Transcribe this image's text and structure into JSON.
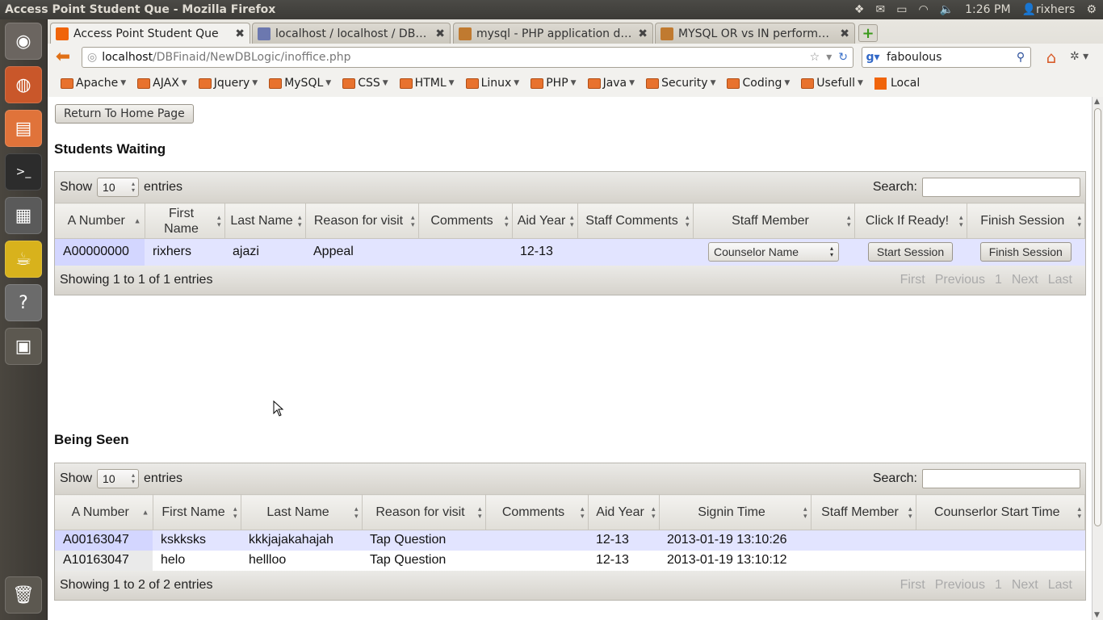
{
  "window": {
    "title": "Access Point Student Que - Mozilla Firefox"
  },
  "tray": {
    "time": "1:26 PM",
    "user": "rixhers"
  },
  "tabs": [
    {
      "label": "Access Point Student Que",
      "active": true,
      "color": "#f0640a"
    },
    {
      "label": "localhost / localhost / DBFi…",
      "active": false,
      "color": "#6c78af"
    },
    {
      "label": "mysql - PHP application dat…",
      "active": false,
      "color": "#c07a30"
    },
    {
      "label": "MYSQL OR vs IN performan…",
      "active": false,
      "color": "#c07a30"
    }
  ],
  "url": {
    "host": "localhost",
    "path": "/DBFinaid/NewDBLogic/inoffice.php"
  },
  "search": {
    "value": "faboulous"
  },
  "bookmarks": [
    "Apache",
    "AJAX",
    "Jquery",
    "MySQL",
    "CSS",
    "HTML",
    "Linux",
    "PHP",
    "Java",
    "Security",
    "Coding",
    "Usefull",
    "Local"
  ],
  "page": {
    "home_button": "Return To Home Page",
    "waiting": {
      "heading": "Students Waiting",
      "show": "Show",
      "entries_label": "entries",
      "length": "10",
      "search_label": "Search:",
      "columns": [
        "A Number",
        "First Name",
        "Last Name",
        "Reason for visit",
        "Comments",
        "Aid Year",
        "Staff Comments",
        "Staff Member",
        "Click If Ready!",
        "Finish Session"
      ],
      "rows": [
        {
          "anumber": "A00000000",
          "first": "rixhers",
          "last": "ajazi",
          "reason": "Appeal",
          "comments": "",
          "aid_year": "12-13",
          "staff_comments": "",
          "staff_select": "Counselor Name",
          "start_btn": "Start Session",
          "finish_btn": "Finish Session"
        }
      ],
      "info": "Showing 1 to 1 of 1 entries",
      "pager": [
        "First",
        "Previous",
        "1",
        "Next",
        "Last"
      ]
    },
    "seen": {
      "heading": "Being Seen",
      "show": "Show",
      "entries_label": "entries",
      "length": "10",
      "search_label": "Search:",
      "columns": [
        "A Number",
        "First Name",
        "Last Name",
        "Reason for visit",
        "Comments",
        "Aid Year",
        "Signin Time",
        "Staff Member",
        "Counserlor Start Time"
      ],
      "rows": [
        {
          "anumber": "A00163047",
          "first": "kskksks",
          "last": "kkkjajakahajah",
          "reason": "Tap Question",
          "comments": "",
          "aid_year": "12-13",
          "signin": "2013-01-19 13:10:26",
          "staff": "",
          "start": ""
        },
        {
          "anumber": "A10163047",
          "first": "helo",
          "last": "hellloo",
          "reason": "Tap Question",
          "comments": "",
          "aid_year": "12-13",
          "signin": "2013-01-19 13:10:12",
          "staff": "",
          "start": ""
        }
      ],
      "info": "Showing 1 to 2 of 2 entries",
      "pager": [
        "First",
        "Previous",
        "1",
        "Next",
        "Last"
      ]
    }
  }
}
